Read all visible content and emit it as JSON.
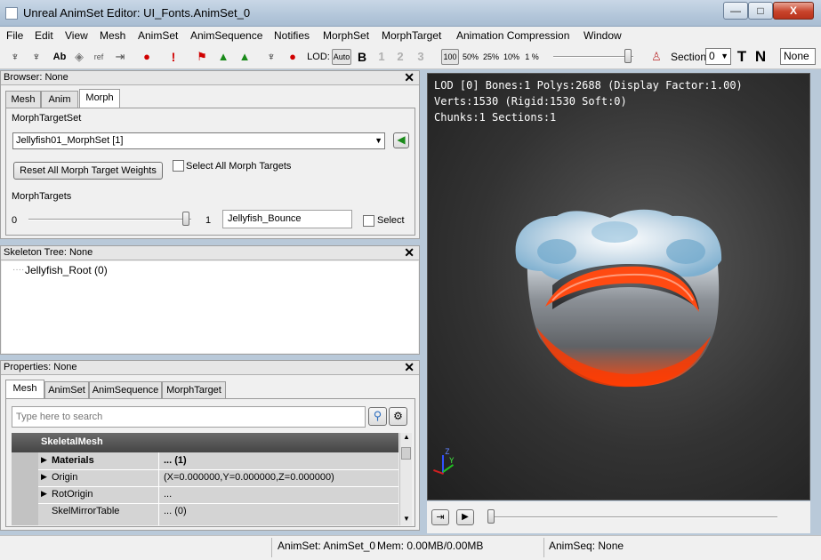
{
  "window": {
    "title": "Unreal AnimSet Editor: UI_Fonts.AnimSet_0",
    "min": "—",
    "max": "□",
    "close": "X"
  },
  "menu": [
    "File",
    "Edit",
    "View",
    "Mesh",
    "AnimSet",
    "AnimSequence",
    "Notifies",
    "MorphSet",
    "MorphTarget",
    "Animation Compression",
    "Window"
  ],
  "toolbar": {
    "lod_label": "LOD:",
    "lod_auto": "Auto",
    "lod_b": "B",
    "lod_1": "1",
    "lod_2": "2",
    "lod_3": "3",
    "zoom": [
      "100",
      "50%",
      "25%",
      "10%",
      "1 %"
    ],
    "section_label": "Section",
    "section_value": "0",
    "t_label": "T",
    "n_label": "N",
    "none_value": "None",
    "ab_label": "Ab",
    "ref_label": "ref",
    "excl_label": "!"
  },
  "browser": {
    "header": "Browser: None",
    "close": "✕",
    "tabs": [
      "Mesh",
      "Anim",
      "Morph"
    ],
    "morph_target_set_label": "MorphTargetSet",
    "morph_set_value": "Jellyfish01_MorphSet [1]",
    "reset_button": "Reset All Morph Target Weights",
    "select_all_label": "Select All Morph Targets",
    "morph_targets_label": "MorphTargets",
    "slider_min": "0",
    "slider_max": "1",
    "target_name": "Jellyfish_Bounce",
    "select_label": "Select"
  },
  "skeleton": {
    "header": "Skeleton Tree: None",
    "close": "✕",
    "root": "Jellyfish_Root (0)"
  },
  "properties": {
    "header": "Properties: None",
    "close": "✕",
    "tabs": [
      "Mesh",
      "AnimSet",
      "AnimSequence",
      "MorphTarget"
    ],
    "search_placeholder": "Type here to search",
    "category": "SkeletalMesh",
    "rows": [
      {
        "name": "Materials",
        "value": "... (1)",
        "bold": true,
        "expand": true
      },
      {
        "name": "Origin",
        "value": "(X=0.000000,Y=0.000000,Z=0.000000)",
        "bold": false,
        "expand": true
      },
      {
        "name": "RotOrigin",
        "value": "...",
        "bold": false,
        "expand": true
      },
      {
        "name": "SkelMirrorTable",
        "value": "... (0)",
        "bold": false,
        "expand": false
      }
    ]
  },
  "viewport": {
    "info_line1": "LOD [0] Bones:1 Polys:2688 (Display Factor:1.00)",
    "info_line2": "Verts:1530 (Rigid:1530 Soft:0)",
    "info_line3": "Chunks:1 Sections:1",
    "axis_z": "Z",
    "axis_y": "Y"
  },
  "timeline": {
    "position": 0.0
  },
  "status": {
    "animset": "AnimSet: AnimSet_0",
    "mem": "Mem: 0.00MB/0.00MB",
    "animseq": "AnimSeq: None"
  }
}
